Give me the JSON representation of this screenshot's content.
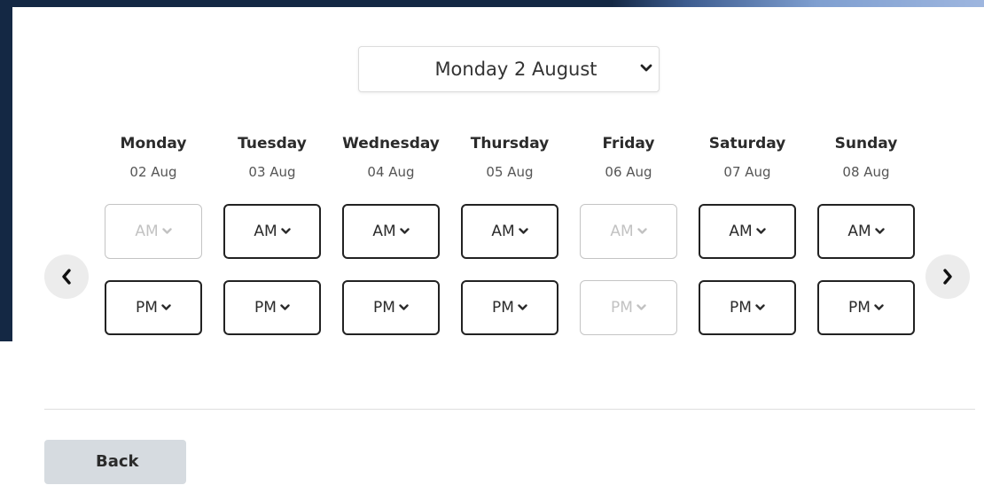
{
  "date_picker": {
    "selected": "Monday 2 August",
    "icon": "calendar-icon",
    "chevron": "chevron-down-icon"
  },
  "days": [
    {
      "name": "Monday",
      "date": "02 Aug",
      "am": {
        "label": "AM",
        "enabled": false
      },
      "pm": {
        "label": "PM",
        "enabled": true
      }
    },
    {
      "name": "Tuesday",
      "date": "03 Aug",
      "am": {
        "label": "AM",
        "enabled": true
      },
      "pm": {
        "label": "PM",
        "enabled": true
      }
    },
    {
      "name": "Wednesday",
      "date": "04 Aug",
      "am": {
        "label": "AM",
        "enabled": true
      },
      "pm": {
        "label": "PM",
        "enabled": true
      }
    },
    {
      "name": "Thursday",
      "date": "05 Aug",
      "am": {
        "label": "AM",
        "enabled": true
      },
      "pm": {
        "label": "PM",
        "enabled": true
      }
    },
    {
      "name": "Friday",
      "date": "06 Aug",
      "am": {
        "label": "AM",
        "enabled": false
      },
      "pm": {
        "label": "PM",
        "enabled": false
      }
    },
    {
      "name": "Saturday",
      "date": "07 Aug",
      "am": {
        "label": "AM",
        "enabled": true
      },
      "pm": {
        "label": "PM",
        "enabled": true
      }
    },
    {
      "name": "Sunday",
      "date": "08 Aug",
      "am": {
        "label": "AM",
        "enabled": true
      },
      "pm": {
        "label": "PM",
        "enabled": true
      }
    }
  ],
  "nav": {
    "prev_icon": "chevron-left-icon",
    "next_icon": "chevron-right-icon"
  },
  "footer": {
    "back_label": "Back"
  },
  "colors": {
    "backdrop": "#142844",
    "accent": "#9eb6df",
    "back_button": "#d6dbe0",
    "disabled_text": "#c2c2c2"
  }
}
